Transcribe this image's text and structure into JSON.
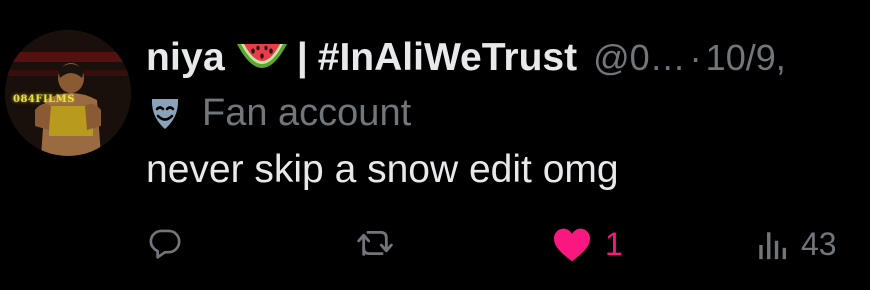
{
  "tweet": {
    "display_name": "niya",
    "separator": "|",
    "hashtag": "#InAliWeTrust",
    "handle": "@0…",
    "dot": "·",
    "date": "10/9,",
    "label": "Fan account",
    "text": "never skip a snow edit omg",
    "avatar_caption": "084FILMS"
  },
  "actions": {
    "reply": {
      "icon": "reply-icon",
      "count": ""
    },
    "retweet": {
      "icon": "retweet-icon",
      "count": ""
    },
    "like": {
      "icon": "heart-icon",
      "count": "1",
      "liked": true
    },
    "views": {
      "icon": "views-icon",
      "count": "43"
    }
  },
  "colors": {
    "background": "#000000",
    "primary_text": "#e7e9ea",
    "secondary_text": "#71767b",
    "like": "#f91880"
  }
}
